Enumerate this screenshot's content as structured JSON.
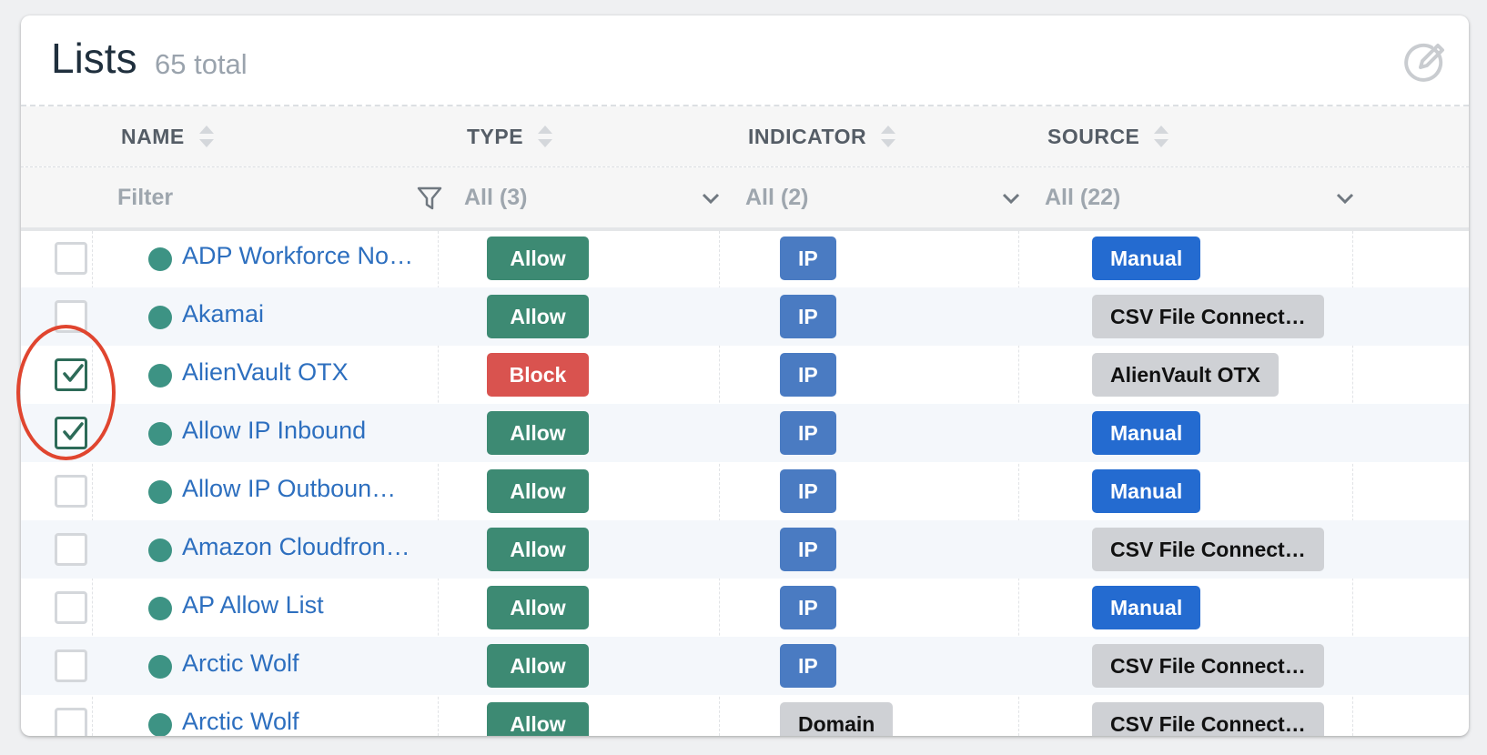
{
  "header": {
    "title": "Lists",
    "total": "65 total",
    "edit_icon": "pencil-circle-icon"
  },
  "columns": {
    "name": "NAME",
    "type": "TYPE",
    "indicator": "INDICATOR",
    "source": "SOURCE"
  },
  "filters": {
    "name_placeholder": "Filter",
    "type": "All (3)",
    "indicator": "All (2)",
    "source": "All (22)"
  },
  "colors": {
    "allow": "#3d8a73",
    "block": "#d9534f",
    "ip": "#4a7bc2",
    "manual": "#246bd0",
    "gray_pill": "#cfd1d5",
    "link": "#2d6fbf",
    "status_dot": "#3d9384",
    "annotation": "#e0452f"
  },
  "rows": [
    {
      "checked": false,
      "name": "ADP Workforce No…",
      "type": "Allow",
      "indicator": "IP",
      "source": "Manual"
    },
    {
      "checked": false,
      "name": "Akamai",
      "type": "Allow",
      "indicator": "IP",
      "source": "CSV File Connect…"
    },
    {
      "checked": true,
      "name": "AlienVault OTX",
      "type": "Block",
      "indicator": "IP",
      "source": "AlienVault OTX"
    },
    {
      "checked": true,
      "name": "Allow IP Inbound",
      "type": "Allow",
      "indicator": "IP",
      "source": "Manual"
    },
    {
      "checked": false,
      "name": "Allow IP Outboun…",
      "type": "Allow",
      "indicator": "IP",
      "source": "Manual"
    },
    {
      "checked": false,
      "name": "Amazon Cloudfron…",
      "type": "Allow",
      "indicator": "IP",
      "source": "CSV File Connect…"
    },
    {
      "checked": false,
      "name": "AP Allow List",
      "type": "Allow",
      "indicator": "IP",
      "source": "Manual"
    },
    {
      "checked": false,
      "name": "Arctic Wolf",
      "type": "Allow",
      "indicator": "IP",
      "source": "CSV File Connect…"
    },
    {
      "checked": false,
      "name": "Arctic Wolf",
      "type": "Allow",
      "indicator": "Domain",
      "source": "CSV File Connect…"
    }
  ]
}
